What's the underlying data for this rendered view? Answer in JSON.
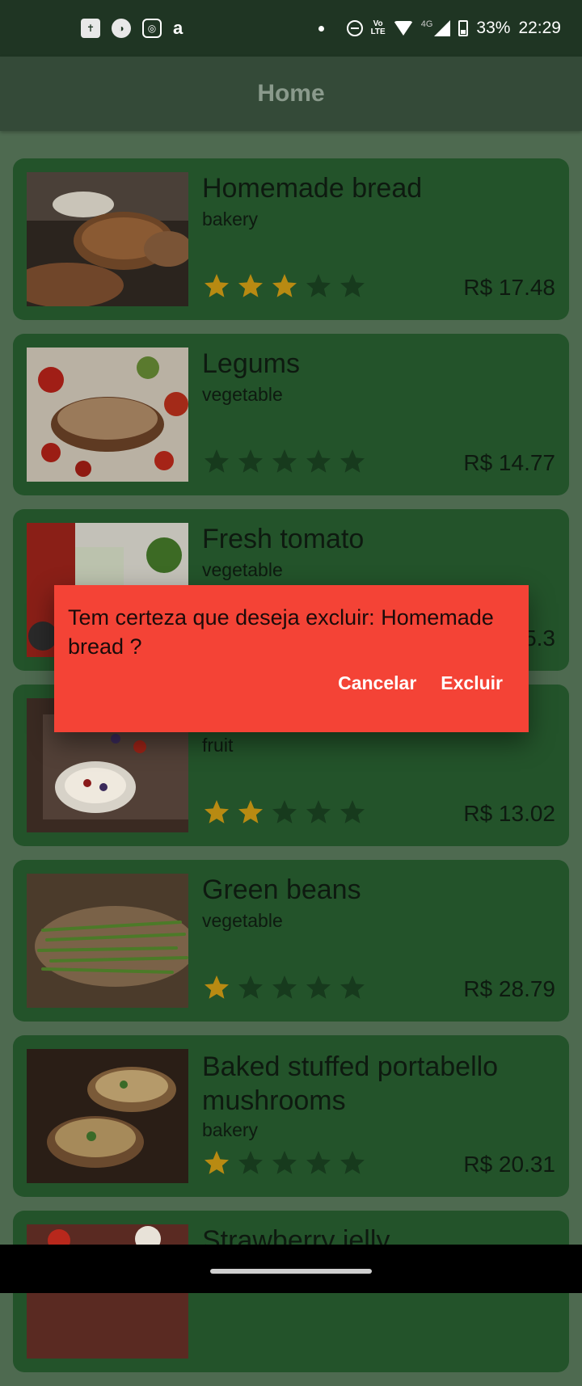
{
  "status_bar": {
    "app_icons": [
      "bible-icon",
      "circle-app-icon",
      "instagram-icon",
      "amazon-icon"
    ],
    "battery_text": "33%",
    "time": "22:29",
    "network_label": "4G",
    "volte_label": "Vo\nLTE"
  },
  "app_bar": {
    "title": "Home"
  },
  "products": [
    {
      "name": "Homemade bread",
      "category": "bakery",
      "rating": 3,
      "price": "R$ 17.48"
    },
    {
      "name": "Legums",
      "category": "vegetable",
      "rating": 0,
      "price": "R$ 14.77"
    },
    {
      "name": "Fresh tomato",
      "category": "vegetable",
      "rating": 0,
      "price": "5.3"
    },
    {
      "name": "",
      "category": "fruit",
      "rating": 2,
      "price": "R$ 13.02"
    },
    {
      "name": "Green beans",
      "category": "vegetable",
      "rating": 1,
      "price": "R$ 28.79"
    },
    {
      "name": "Baked stuffed portabello mushrooms",
      "category": "bakery",
      "rating": 1,
      "price": "R$ 20.31"
    },
    {
      "name": "Strawberry jelly",
      "category": "",
      "rating": 0,
      "price": ""
    }
  ],
  "dialog": {
    "message": "Tem certeza que deseja excluir: Homemade bread ?",
    "cancel_label": "Cancelar",
    "confirm_label": "Excluir"
  },
  "colors": {
    "card": "#23532a",
    "background": "#4e6a50",
    "dialog": "#f44336",
    "star_filled": "#b88a12",
    "star_empty": "#173a1d"
  }
}
